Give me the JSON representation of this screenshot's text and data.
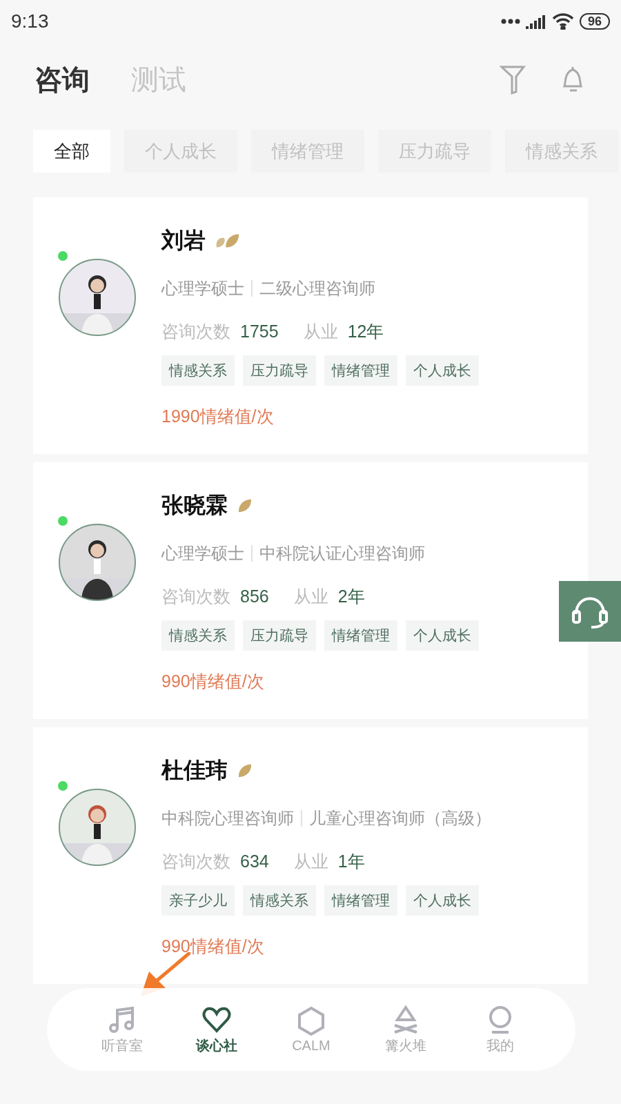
{
  "status_bar": {
    "time": "9:13",
    "battery": "96"
  },
  "header": {
    "tabs": [
      {
        "label": "咨询",
        "selected": true
      },
      {
        "label": "测试",
        "selected": false
      }
    ]
  },
  "categories": [
    {
      "label": "全部",
      "selected": true
    },
    {
      "label": "个人成长",
      "selected": false
    },
    {
      "label": "情绪管理",
      "selected": false
    },
    {
      "label": "压力疏导",
      "selected": false
    },
    {
      "label": "情感关系",
      "selected": false
    }
  ],
  "counselors": [
    {
      "name": "刘岩",
      "online": true,
      "kind": "double",
      "credentials": [
        "心理学硕士",
        "二级心理咨询师"
      ],
      "stats": [
        {
          "label": "咨询次数",
          "value": "1755"
        },
        {
          "label": "从业",
          "value": "12年"
        }
      ],
      "tags": [
        "情感关系",
        "压力疏导",
        "情绪管理",
        "个人成长"
      ],
      "price": "1990情绪值/次"
    },
    {
      "name": "张晓霖",
      "online": true,
      "kind": "single",
      "credentials": [
        "心理学硕士",
        "中科院认证心理咨询师"
      ],
      "stats": [
        {
          "label": "咨询次数",
          "value": "856"
        },
        {
          "label": "从业",
          "value": "2年"
        }
      ],
      "tags": [
        "情感关系",
        "压力疏导",
        "情绪管理",
        "个人成长"
      ],
      "price": "990情绪值/次"
    },
    {
      "name": "杜佳玮",
      "online": true,
      "kind": "single",
      "credentials": [
        "中科院心理咨询师",
        "儿童心理咨询师（高级）"
      ],
      "stats": [
        {
          "label": "咨询次数",
          "value": "634"
        },
        {
          "label": "从业",
          "value": "1年"
        }
      ],
      "tags": [
        "亲子少儿",
        "情感关系",
        "情绪管理",
        "个人成长"
      ],
      "price": "990情绪值/次"
    }
  ],
  "annotation": {
    "kind": "arrow"
  },
  "bottom_nav": [
    {
      "label": "听音室",
      "selected": false
    },
    {
      "label": "谈心社",
      "selected": true
    },
    {
      "label": "CALM",
      "selected": false
    },
    {
      "label": "篝火堆",
      "selected": false
    },
    {
      "label": "我的",
      "selected": false
    }
  ]
}
